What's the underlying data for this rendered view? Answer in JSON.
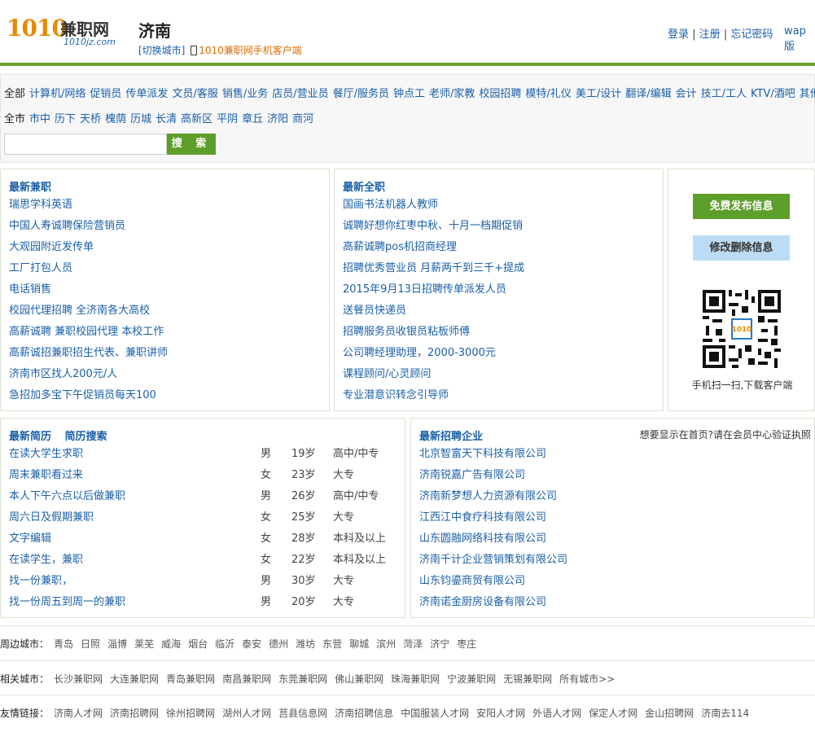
{
  "header": {
    "logo_num": "1010",
    "logo_cn": "兼职网",
    "logo_sub": "1010jz.com",
    "city": "济南",
    "switch_city": "[切换城市]",
    "app_link": "1010兼职网手机客户端",
    "login": "登录",
    "register": "注册",
    "forgot": "忘记密码",
    "sep": " | ",
    "wap": "wap版"
  },
  "filters": {
    "categories_current": "全部",
    "categories": [
      "计算机/网络",
      "促销员",
      "传单派发",
      "文员/客服",
      "销售/业务",
      "店员/营业员",
      "餐厅/服务员",
      "钟点工",
      "老师/家教",
      "校园招聘",
      "模特/礼仪",
      "美工/设计",
      "翻译/编辑",
      "会计",
      "技工/工人",
      "KTV/酒吧",
      "其他"
    ],
    "areas_current": "全市",
    "areas": [
      "市中",
      "历下",
      "天桥",
      "槐荫",
      "历城",
      "长清",
      "高新区",
      "平阴",
      "章丘",
      "济阳",
      "商河"
    ],
    "search_label": "搜 索"
  },
  "latest_jobs": {
    "title": "最新兼职",
    "items": [
      "瑞思学科英语",
      "中国人寿诚聘保险营销员",
      "大观园附近发传单",
      "工厂打包人员",
      "电话销售",
      "校园代理招聘 全济南各大高校",
      "高薪诚聘 兼职校园代理 本校工作",
      "高薪诚招兼职招生代表、兼职讲师",
      "济南市区找人200元/人",
      "急招加多宝下午促销员每天100"
    ]
  },
  "latest_full": {
    "title": "最新全职",
    "items": [
      "国画书法机器人教师",
      "诚聘好想你红枣中秋、十月一档期促销",
      "高薪诚聘pos机招商经理",
      "招聘优秀营业员 月薪两千到三千+提成",
      "2015年9月13日招聘传单派发人员",
      "送餐员快递员",
      "招聘服务员收银员粘板师傅",
      "公司聘经理助理，2000-3000元",
      "课程顾问/心灵顾问",
      "专业潜意识转念引导师"
    ]
  },
  "side": {
    "publish": "免费发布信息",
    "edit": "修改删除信息",
    "qr_caption": "手机扫一扫,下载客户端"
  },
  "resumes": {
    "title": "最新简历",
    "search": "简历搜索",
    "rows": [
      [
        "在读大学生求职",
        "男",
        "19岁",
        "高中/中专"
      ],
      [
        "周末兼职看过来",
        "女",
        "23岁",
        "大专"
      ],
      [
        "本人下午六点以后做兼职",
        "男",
        "26岁",
        "高中/中专"
      ],
      [
        "周六日及假期兼职",
        "女",
        "25岁",
        "大专"
      ],
      [
        "文字编辑",
        "女",
        "28岁",
        "本科及以上"
      ],
      [
        "在读学生，兼职",
        "女",
        "22岁",
        "本科及以上"
      ],
      [
        "找一份兼职，",
        "男",
        "30岁",
        "大专"
      ],
      [
        "找一份周五到周一的兼职",
        "男",
        "20岁",
        "大专"
      ]
    ]
  },
  "companies": {
    "title": "最新招聘企业",
    "note": "想要显示在首页?请在会员中心验证执照",
    "items": [
      "北京智富天下科技有限公司",
      "济南锐嘉广告有限公司",
      "济南新梦想人力资源有限公司",
      "江西江中食疗科技有限公司",
      "山东圆融网络科技有限公司",
      "济南千计企业营销策划有限公司",
      "山东钧鎏商贸有限公司",
      "济南诺金厨房设备有限公司"
    ]
  },
  "footer": {
    "nearby_label": "周边城市：",
    "nearby": [
      "青岛",
      "日照",
      "淄博",
      "莱芜",
      "威海",
      "烟台",
      "临沂",
      "泰安",
      "德州",
      "潍坊",
      "东营",
      "聊城",
      "滨州",
      "菏泽",
      "济宁",
      "枣庄"
    ],
    "related_label": "相关城市：",
    "related": [
      "长沙兼职网",
      "大连兼职网",
      "青岛兼职网",
      "南昌兼职网",
      "东莞兼职网",
      "佛山兼职网",
      "珠海兼职网",
      "宁波兼职网",
      "无锡兼职网",
      "所有城市>>"
    ],
    "friends_label": "友情链接：",
    "friends": [
      "济南人才网",
      "济南招聘网",
      "徐州招聘网",
      "湖州人才网",
      "莒县信息网",
      "济南招聘信息",
      "中国服装人才网",
      "安阳人才网",
      "外语人才网",
      "保定人才网",
      "金山招聘网",
      "济南去114"
    ]
  }
}
